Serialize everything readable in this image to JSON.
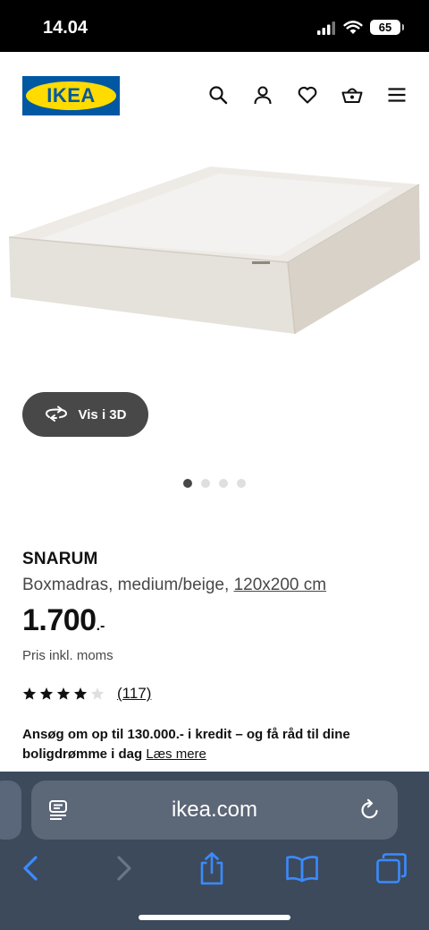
{
  "status": {
    "time": "14.04",
    "battery": "65"
  },
  "header": {
    "logo_text": "IKEA",
    "icons": [
      "search-icon",
      "account-icon",
      "heart-icon",
      "basket-icon",
      "menu-icon"
    ]
  },
  "product": {
    "view_3d_label": "Vis i 3D",
    "carousel_total": 4,
    "carousel_active": 1,
    "name": "SNARUM",
    "description": "Boxmadras, medium/beige,",
    "size": "120x200 cm",
    "price": "1.700",
    "price_suffix": ".-",
    "price_note": "Pris inkl. moms",
    "rating": 4,
    "rating_max": 5,
    "review_count": "(117)",
    "credit_text": "Ansøg om op til 130.000.- i kredit – og få råd til dine boligdrømme i dag",
    "read_more": "Læs mere"
  },
  "browser": {
    "url": "ikea.com",
    "icons": [
      "reader-icon",
      "reload-icon",
      "back-icon",
      "forward-icon",
      "share-icon",
      "bookmarks-icon",
      "tabs-icon"
    ]
  },
  "colors": {
    "ikea_blue": "#0058a3",
    "ikea_yellow": "#ffdb00",
    "safari_blue": "#3a8bff",
    "browser_bg": "#3c4a5c"
  }
}
